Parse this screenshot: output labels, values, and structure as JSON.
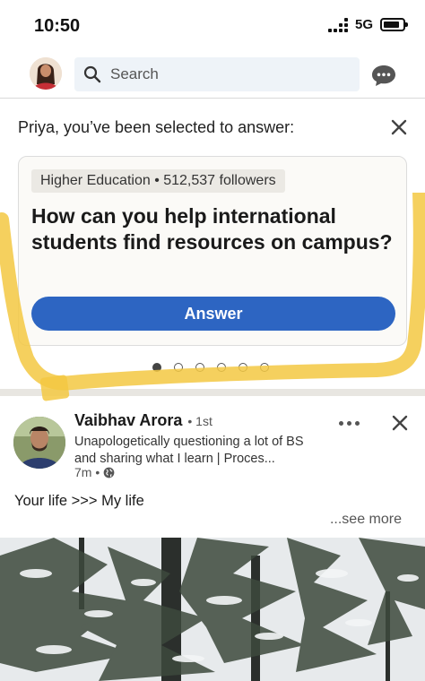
{
  "status_bar": {
    "time": "10:50",
    "network": "5G",
    "battery_level": 0.85
  },
  "top_nav": {
    "avatar_icon": "profile-photo",
    "search_placeholder": "Search",
    "messaging_icon": "chat-bubble-icon"
  },
  "answer_prompt": {
    "heading": "Priya, you’ve been selected to answer:",
    "topic_chip": "Higher Education • 512,537 followers",
    "question": "How can you help international students find resources on campus?",
    "answer_label": "Answer",
    "pages_total": 6,
    "page_active": 1
  },
  "post": {
    "author_name": "Vaibhav Arora",
    "degree": "• 1st",
    "headline": "Unapologetically questioning a lot of BS and sharing what I learn | Proces...",
    "time": "7m •",
    "visibility_icon": "globe-icon",
    "text": "Your life >>> My life",
    "see_more": "...see more",
    "image": "snowy-forest-photo"
  },
  "colors": {
    "accent": "#2d65c2",
    "highlight": "#f3c842",
    "search_bg": "#eef3f8"
  }
}
